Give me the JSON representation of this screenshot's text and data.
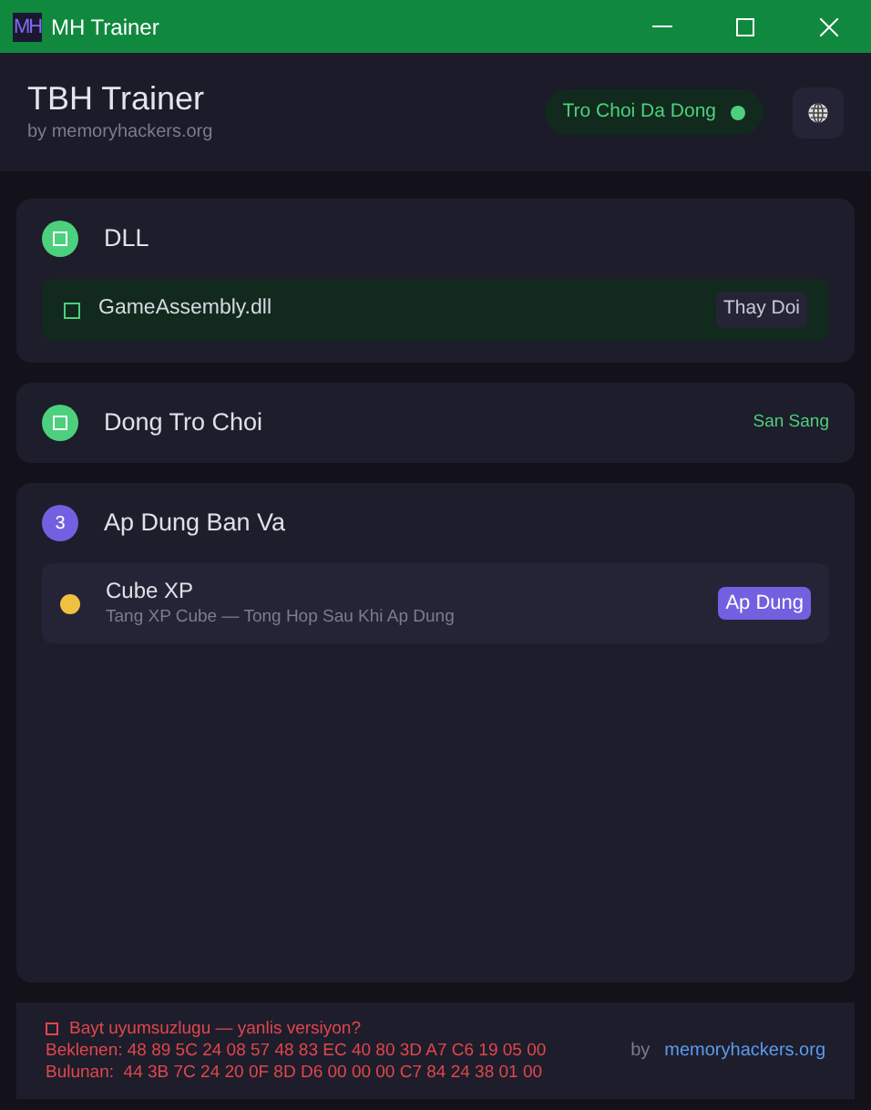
{
  "window": {
    "title": "MH Trainer",
    "logo": "MH"
  },
  "header": {
    "title": "TBH Trainer",
    "subtitle": "by memoryhackers.org",
    "status": {
      "label": "Tro Choi Da Dong",
      "on": true
    }
  },
  "steps": [
    {
      "kind": "done",
      "title": "DLL",
      "item": {
        "kind": "file",
        "name": "GameAssembly.dll",
        "action": "Thay Doi"
      }
    },
    {
      "kind": "done",
      "title": "Dong Tro Choi",
      "status": "San Sang"
    },
    {
      "kind": "number",
      "badge": "3",
      "title": "Ap Dung Ban Va",
      "item": {
        "kind": "patch",
        "name": "Cube XP",
        "description": "Tang XP Cube — Tong Hop Sau Khi Ap Dung",
        "action": "Ap Dung",
        "color": "#f0c040"
      }
    }
  ],
  "footer": {
    "error": {
      "title": "Bayt uyumsuzlugu — yanlis versiyon?",
      "lines": [
        "Beklenen: 48 89 5C 24 08 57 48 83 EC 40 80 3D A7 C6 19 05 00",
        "Bulunan:  44 3B 7C 24 20 0F 8D D6 00 00 00 C7 84 24 38 01 00"
      ]
    },
    "by": "by",
    "link": "memoryhackers.org"
  }
}
